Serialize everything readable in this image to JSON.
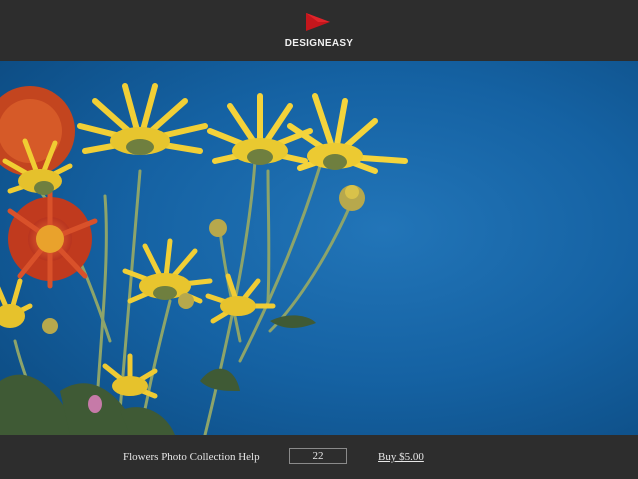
{
  "header": {
    "brand": "DESIGNEASY",
    "logo_icon": "play-triangle-icon",
    "logo_color": "#c4161c"
  },
  "photo": {
    "subject": "flowers-photo",
    "background_color": "#16609f"
  },
  "footer": {
    "title": "Flowers Photo Collection Help",
    "page_number": "22",
    "buy_label": "Buy $5.00"
  }
}
